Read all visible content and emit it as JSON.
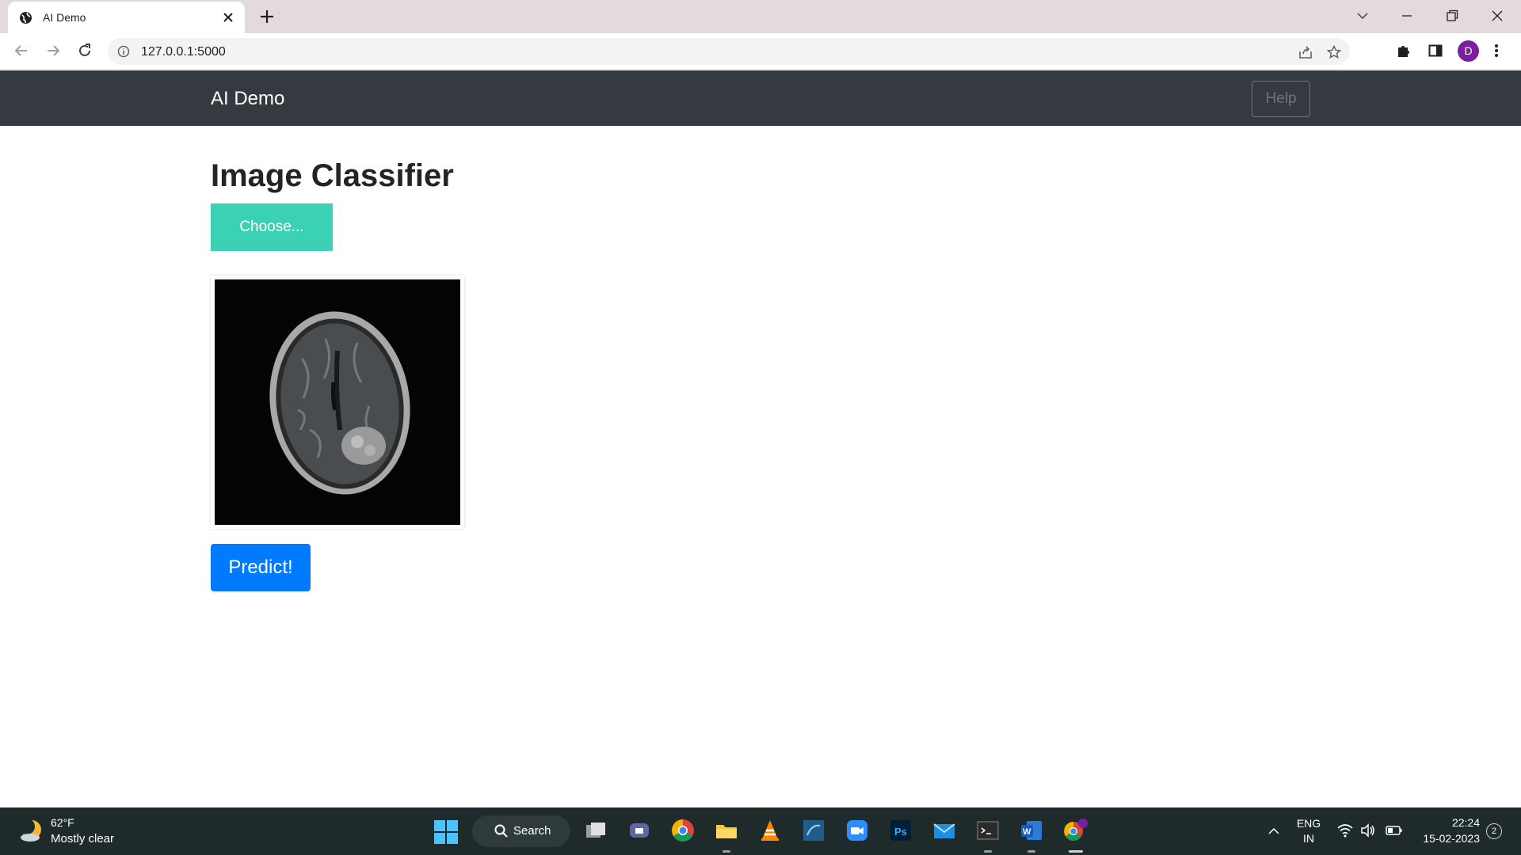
{
  "browser": {
    "tab_title": "AI Demo",
    "url": "127.0.0.1:5000",
    "profile_initial": "D"
  },
  "page": {
    "brand": "AI Demo",
    "help_label": "Help",
    "title": "Image Classifier",
    "choose_label": "Choose...",
    "predict_label": "Predict!",
    "colors": {
      "navbar": "#343a40",
      "choose_button": "#3ad1b5",
      "predict_button": "#007bff"
    }
  },
  "taskbar": {
    "temperature": "62°F",
    "weather": "Mostly clear",
    "search_label": "Search",
    "language_line1": "ENG",
    "language_line2": "IN",
    "time": "22:24",
    "date": "15-02-2023",
    "notification_count": "2",
    "apps": [
      "task-view-icon",
      "teams-icon",
      "chrome-icon",
      "file-explorer-icon",
      "vlc-icon",
      "mysql-workbench-icon",
      "zoom-icon",
      "photoshop-icon",
      "mail-icon",
      "terminal-icon",
      "word-icon",
      "chrome-profile-icon"
    ]
  }
}
